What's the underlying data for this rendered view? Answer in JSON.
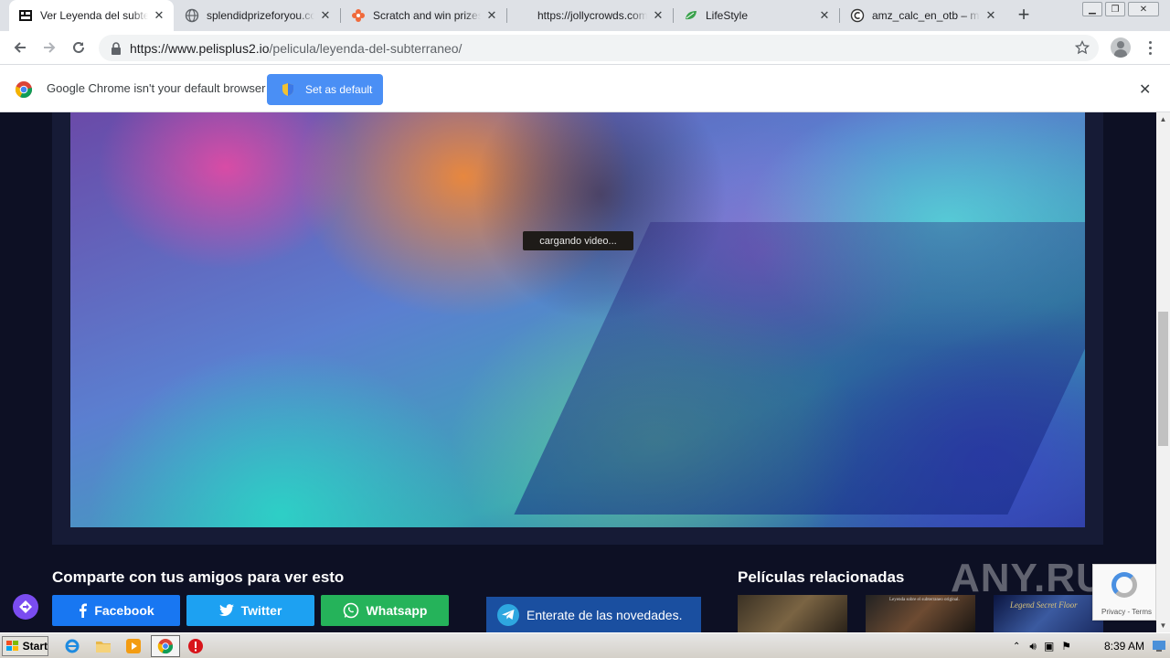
{
  "browser": {
    "tabs": [
      {
        "title": "Ver Leyenda del subterraneo",
        "active": true,
        "favicon": "film-icon"
      },
      {
        "title": "splendidprizeforyou.com",
        "active": false,
        "favicon": "globe-icon"
      },
      {
        "title": "Scratch and win prizes e",
        "active": false,
        "favicon": "flower-icon"
      },
      {
        "title": "https://jollycrowds.com/",
        "active": false,
        "favicon": "none"
      },
      {
        "title": "LifeStyle",
        "active": false,
        "favicon": "leaf-icon"
      },
      {
        "title": "amz_calc_en_otb – mysi",
        "active": false,
        "favicon": "c-logo-icon"
      }
    ],
    "url_host": "https://www.pelisplus2.io",
    "url_path": "/pelicula/leyenda-del-subterraneo/",
    "infobar": {
      "message": "Google Chrome isn't your default browser",
      "button": "Set as default"
    }
  },
  "page": {
    "player": {
      "status": "cargando video..."
    },
    "share": {
      "title": "Comparte con tus amigos para ver esto",
      "buttons": [
        "Facebook",
        "Twitter",
        "Whatsapp"
      ]
    },
    "telegram": "Enterate de las novedades.",
    "related": {
      "title": "Películas relacionadas",
      "thumb2_text": "Leyenda sobre el subterraneo original.",
      "thumb3_text": "Legend Secret Floor"
    },
    "watermark": "ANY.RUN",
    "recaptcha": "Privacy - Terms"
  },
  "taskbar": {
    "start": "Start",
    "clock": "8:39 AM"
  },
  "colors": {
    "accent": "#4a8ff5",
    "facebook": "#1877f2",
    "twitter": "#1da1f2",
    "whatsapp": "#25b35a",
    "page_bg": "#0d1024"
  }
}
